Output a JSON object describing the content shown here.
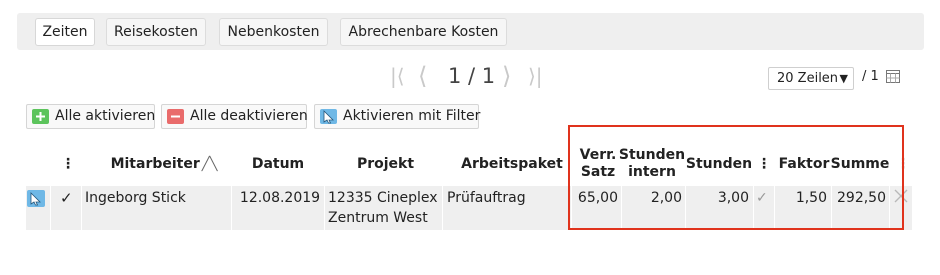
{
  "tabs": [
    {
      "label": "Zeiten",
      "active": true
    },
    {
      "label": "Reisekosten",
      "active": false
    },
    {
      "label": "Nebenkosten",
      "active": false
    },
    {
      "label": "Abrechenbare Kosten",
      "active": false
    }
  ],
  "pager": {
    "first_icon": "first-page-icon",
    "prev_icon": "prev-page-icon",
    "text": "1 / 1",
    "next_icon": "next-page-icon",
    "last_icon": "last-page-icon",
    "rows_per_page": "20 Zeilen",
    "total_pages": "/ 1",
    "calendar_icon": "calendar-icon"
  },
  "actions": {
    "activate_all": "Alle aktivieren",
    "deactivate_all": "Alle deaktivieren",
    "activate_filter": "Aktivieren mit Filter"
  },
  "table": {
    "headers": {
      "employee": "Mitarbeiter",
      "employee_sort": "╱╲",
      "date": "Datum",
      "project": "Projekt",
      "work_package": "Arbeitspaket",
      "rate": "Verr. Satz",
      "hours_internal": "Stunden intern",
      "hours": "Stunden",
      "factor": "Faktor",
      "sum": "Summe"
    },
    "rows": [
      {
        "checked": "✓",
        "employee": "Ingeborg Stick",
        "date": "12.08.2019",
        "project": "12335 Cineplex Zentrum West",
        "work_package": "Prüfauftrag",
        "rate": "65,00",
        "hours_internal": "2,00",
        "hours": "3,00",
        "hours_check": "✓",
        "factor": "1,50",
        "sum": "292,50"
      }
    ]
  },
  "colors": {
    "green_icon": "#5cc45c",
    "red_icon": "#e96b6b",
    "filter_icon_bg": "#6fb8e6",
    "highlight": "#e0331d"
  }
}
